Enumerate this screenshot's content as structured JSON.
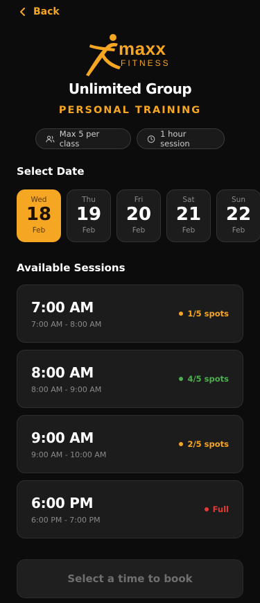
{
  "header": {
    "back_label": "Back"
  },
  "logo": {
    "word1": "maxx",
    "word2": "FITNESS"
  },
  "title": "Unlimited Group",
  "subtitle": "PERSONAL TRAINING",
  "pills": [
    {
      "label": "Max 5 per class",
      "icon": "people-icon"
    },
    {
      "label": "1 hour session",
      "icon": "clock-icon"
    }
  ],
  "dates_title": "Select Date",
  "dates": [
    {
      "dow": "Wed",
      "num": "18",
      "mon": "Feb",
      "selected": true
    },
    {
      "dow": "Thu",
      "num": "19",
      "mon": "Feb"
    },
    {
      "dow": "Fri",
      "num": "20",
      "mon": "Feb"
    },
    {
      "dow": "Sat",
      "num": "21",
      "mon": "Feb"
    },
    {
      "dow": "Sun",
      "num": "22",
      "mon": "Feb"
    }
  ],
  "sessions_title": "Available Sessions",
  "sessions": [
    {
      "time": "7:00 AM",
      "range": "7:00 AM - 8:00 AM",
      "status": "1/5 spots",
      "color": "#f5a623"
    },
    {
      "time": "8:00 AM",
      "range": "8:00 AM - 9:00 AM",
      "status": "4/5 spots",
      "color": "#4caf50"
    },
    {
      "time": "9:00 AM",
      "range": "9:00 AM - 10:00 AM",
      "status": "2/5 spots",
      "color": "#f5a623"
    },
    {
      "time": "6:00 PM",
      "range": "6:00 PM - 7:00 PM",
      "status": "Full",
      "color": "#e53935"
    }
  ],
  "book_label": "Select a time to book",
  "colors": {
    "accent": "#f5a623",
    "background": "#0c0c0c",
    "card": "#1c1c1c"
  }
}
